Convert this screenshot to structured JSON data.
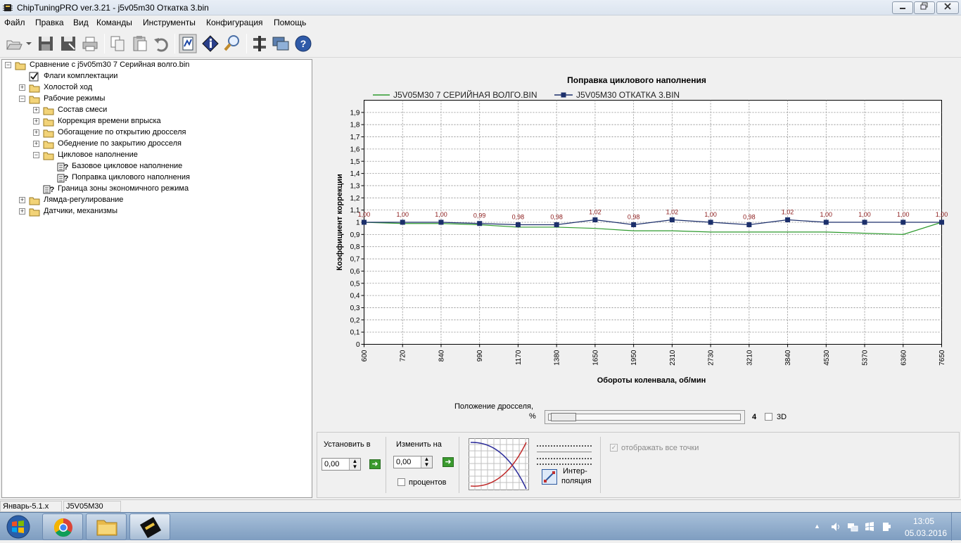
{
  "window": {
    "title": "ChipTuningPRO ver.3.21 - j5v05m30 Откатка 3.bin"
  },
  "menu": [
    "Файл",
    "Правка",
    "Вид",
    "Команды",
    "Инструменты",
    "Конфигурация",
    "Помощь"
  ],
  "toolbar_icons": [
    "open-icon",
    "save-icon",
    "save-as-icon",
    "print-icon",
    "copy-icon",
    "paste-icon",
    "undo-icon",
    "map-view-icon",
    "info-icon",
    "search-icon",
    "settings-icon",
    "network-icon",
    "help-icon"
  ],
  "tree": [
    {
      "label": "Сравнение с j5v05m30 7 Серийная волго.bin",
      "level": 0,
      "type": "folder",
      "expander": "−"
    },
    {
      "label": "Флаги комплектации",
      "level": 1,
      "type": "flag",
      "expander": ""
    },
    {
      "label": "Холостой ход",
      "level": 1,
      "type": "folder",
      "expander": "+"
    },
    {
      "label": "Рабочие режимы",
      "level": 1,
      "type": "folder",
      "expander": "−"
    },
    {
      "label": "Состав смеси",
      "level": 2,
      "type": "folder",
      "expander": "+"
    },
    {
      "label": "Коррекция времени впрыска",
      "level": 2,
      "type": "folder",
      "expander": "+"
    },
    {
      "label": "Обогащение по открытию дросселя",
      "level": 2,
      "type": "folder",
      "expander": "+"
    },
    {
      "label": "Обеднение по закрытию дросселя",
      "level": 2,
      "type": "folder",
      "expander": "+"
    },
    {
      "label": "Цикловое наполнение",
      "level": 2,
      "type": "folder",
      "expander": "−"
    },
    {
      "label": "Базовое цикловое наполнение",
      "level": 3,
      "type": "table",
      "expander": ""
    },
    {
      "label": "Поправка циклового наполнения",
      "level": 3,
      "type": "table",
      "expander": ""
    },
    {
      "label": "Граница зоны экономичного режима",
      "level": 2,
      "type": "table",
      "expander": ""
    },
    {
      "label": "Лямда-регулирование",
      "level": 1,
      "type": "folder",
      "expander": "+"
    },
    {
      "label": "Датчики, механизмы",
      "level": 1,
      "type": "folder",
      "expander": "+"
    }
  ],
  "chart_data": {
    "type": "line",
    "title": "Поправка циклового наполнения",
    "xlabel": "Обороты коленвала, об/мин",
    "ylabel": "Коэффициент коррекции",
    "categories": [
      "600",
      "720",
      "840",
      "990",
      "1170",
      "1380",
      "1650",
      "1950",
      "2310",
      "2730",
      "3210",
      "3840",
      "4530",
      "5370",
      "6360",
      "7650"
    ],
    "ylim": [
      0,
      2
    ],
    "yticks": [
      "0",
      "0,1",
      "0,2",
      "0,3",
      "0,4",
      "0,5",
      "0,6",
      "0,7",
      "0,8",
      "0,9",
      "1",
      "1,1",
      "1,2",
      "1,3",
      "1,4",
      "1,5",
      "1,6",
      "1,7",
      "1,8",
      "1,9"
    ],
    "grid": true,
    "legend_position": "top",
    "series": [
      {
        "name": "J5V05M30 7 СЕРИЙНАЯ ВОЛГО.BIN",
        "color": "#2e9a2e",
        "marker": "none",
        "values": [
          1.0,
          0.99,
          0.99,
          0.98,
          0.96,
          0.96,
          0.95,
          0.93,
          0.93,
          0.92,
          0.92,
          0.92,
          0.92,
          0.91,
          0.9,
          1.0
        ]
      },
      {
        "name": "J5V05M30 ОТКАТКА 3.BIN",
        "color": "#1c2f6b",
        "marker": "square",
        "values": [
          1.0,
          1.0,
          1.0,
          0.99,
          0.98,
          0.98,
          1.02,
          0.98,
          1.02,
          1.0,
          0.98,
          1.02,
          1.0,
          1.0,
          1.0,
          1.0
        ],
        "labels": [
          "1,00",
          "1,00",
          "1,00",
          "0,99",
          "0,98",
          "0,98",
          "1,02",
          "0,98",
          "1,02",
          "1,00",
          "0,98",
          "1,02",
          "1,00",
          "1,00",
          "1,00",
          "1,00"
        ]
      }
    ]
  },
  "throttle": {
    "label_line1": "Положение дросселя,",
    "label_line2": "%",
    "value": "4",
    "checkbox_3d": "3D"
  },
  "bottom": {
    "set_label": "Установить в",
    "set_value": "0,00",
    "change_label": "Изменить на",
    "change_value": "0,00",
    "percent_label": "процентов",
    "interp_line1": "Интер-",
    "interp_line2": "поляция",
    "show_all_label": "отображать все точки"
  },
  "status": {
    "left": "Январь-5.1.x",
    "right": "J5V05M30"
  },
  "taskbar": {
    "time": "13:05",
    "date": "05.03.2016"
  },
  "colors": {
    "accent_green": "#2e9a2e",
    "accent_navy": "#1c2f6b",
    "label_red": "#8b1a1a"
  }
}
